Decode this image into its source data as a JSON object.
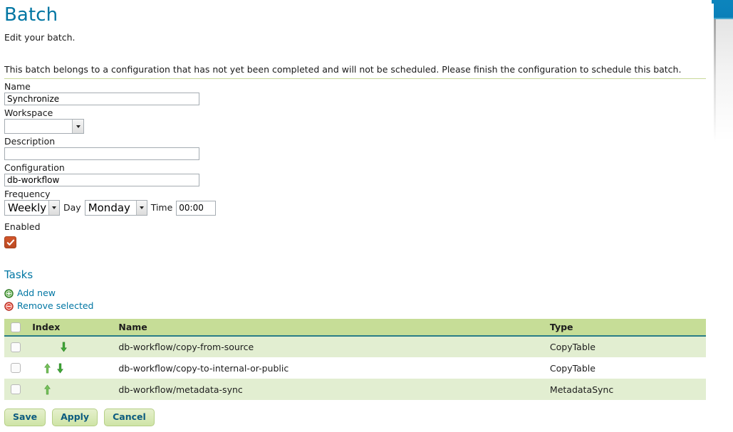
{
  "header": {
    "title": "Batch",
    "subtitle": "Edit your batch."
  },
  "notice": {
    "text": "This batch belongs to a configuration that has not yet been completed and will not be scheduled. Please finish the configuration to schedule this batch."
  },
  "form": {
    "name": {
      "label": "Name",
      "value": "Synchronize",
      "placeholder": ""
    },
    "workspace": {
      "label": "Workspace",
      "value": "",
      "options": [
        ""
      ]
    },
    "description": {
      "label": "Description",
      "value": "",
      "placeholder": ""
    },
    "configuration": {
      "label": "Configuration",
      "value": "db-workflow",
      "placeholder": ""
    },
    "frequency": {
      "label": "Frequency",
      "period": {
        "value": "Weekly",
        "options": [
          "Weekly"
        ]
      },
      "day_label": "Day",
      "day": {
        "value": "Monday",
        "options": [
          "Monday"
        ]
      },
      "time_label": "Time",
      "time": {
        "value": "00:00",
        "placeholder": ""
      }
    },
    "enabled": {
      "label": "Enabled",
      "checked": true
    }
  },
  "tasks": {
    "title": "Tasks",
    "actions": [
      {
        "label": "Add new",
        "icon": "add-circle-icon"
      },
      {
        "label": "Remove selected",
        "icon": "remove-circle-icon"
      }
    ],
    "columns": [
      "",
      "Index",
      "Name",
      "Type"
    ],
    "rows": [
      {
        "selected": false,
        "move_up": false,
        "move_down": true,
        "name": "db-workflow/copy-from-source",
        "type": "CopyTable"
      },
      {
        "selected": false,
        "move_up": true,
        "move_down": true,
        "name": "db-workflow/copy-to-internal-or-public",
        "type": "CopyTable"
      },
      {
        "selected": false,
        "move_up": true,
        "move_down": false,
        "name": "db-workflow/metadata-sync",
        "type": "MetadataSync"
      }
    ]
  },
  "footer": {
    "save": "Save",
    "apply": "Apply",
    "cancel": "Cancel"
  },
  "colors": {
    "link": "#0076a3",
    "table_header": "#c6dd97",
    "row_alt": "#e2eed1",
    "button_bg": "#cfe4a6",
    "checkbox_checked": "#c2502a",
    "accent_blue": "#0c84bd",
    "arrow_up": "#77c25a",
    "arrow_down": "#3faa36"
  }
}
